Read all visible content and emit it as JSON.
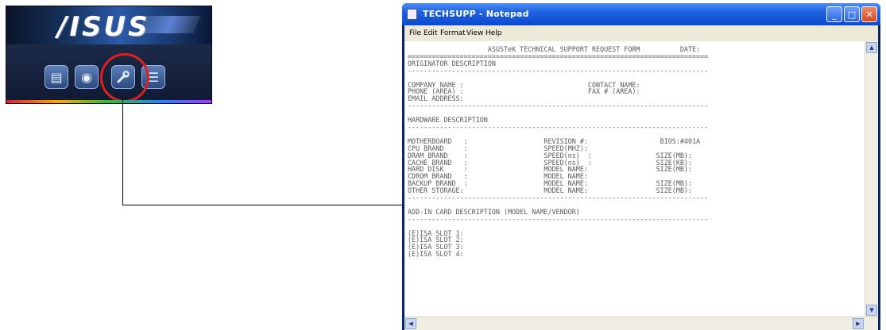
{
  "asus_panel": {
    "logo": "/ISUS",
    "buttons": [
      {
        "name": "notes-icon",
        "glyph": "▤"
      },
      {
        "name": "cd-icon",
        "glyph": "◉"
      },
      {
        "name": "wrench-icon",
        "glyph": "🔧"
      },
      {
        "name": "list-icon",
        "glyph": "☰"
      }
    ]
  },
  "notepad": {
    "title": "TECHSUPP - Notepad",
    "menu": [
      "File",
      "Edit",
      "Format",
      "View",
      "Help"
    ],
    "window_buttons": {
      "minimize": "_",
      "maximize": "□",
      "close": "✕"
    },
    "lines": [
      "                    ASUSTeK TECHNICAL SUPPORT REQUEST FORM          DATE:",
      "===========================================================================",
      "ORIGINATOR DESCRIPTION",
      "---------------------------------------------------------------------------",
      "",
      "COMPANY NAME :                               CONTACT NAME:",
      "PHONE (AREA) :                               FAX # (AREA):",
      "EMAIL ADDRESS:",
      "---------------------------------------------------------------------------",
      "",
      "HARDWARE DESCRIPTION",
      "---------------------------------------------------------------------------",
      "",
      "MOTHERBOARD   :                   REVISION #:                  BIOS:#401A",
      "CPU BRAND     :                   SPEED(MHZ):",
      "DRAM BRAND    :                   SPEED(ns)  :                SIZE(MB):",
      "CACHE BRAND   :                   SPEED(ns)  :                SIZE(KB):",
      "HARD DISK     :                   MODEL NAME:                 SIZE(MB):",
      "CDROM BRAND   :                   MODEL NAME:",
      "BACKUP BRAND  :                   MODEL NAME:                 SIZE(MB):",
      "OTHER STORAGE:                    MODEL NAME:                 SIZE(MB):",
      "---------------------------------------------------------------------------",
      "",
      "ADD-IN CARD DESCRIPTION (MODEL NAME/VENDOR)",
      "---------------------------------------------------------------------------",
      "",
      "(E)ISA SLOT 1:",
      "(E)ISA SLOT 2:",
      "(E)ISA SLOT 3:",
      "(E)ISA SLOT 4:"
    ]
  }
}
